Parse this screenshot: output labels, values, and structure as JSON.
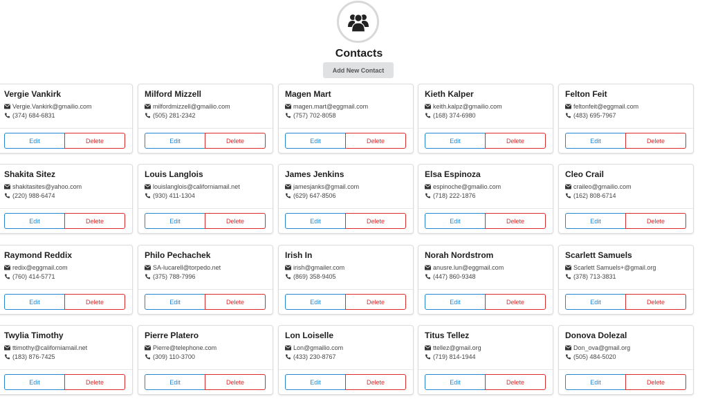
{
  "page": {
    "title": "Contacts",
    "add_button_label": "Add New Contact",
    "logo_icon": "users-icon"
  },
  "colors": {
    "edit": "#2185d0",
    "delete": "#db2828",
    "add_button_bg": "#e0e1e2"
  },
  "labels": {
    "edit": "Edit",
    "delete": "Delete"
  },
  "contacts": [
    {
      "name": "Vergie Vankirk",
      "email": "Vergie.Vankirk@gmailio.com",
      "phone": "(374) 684-6831"
    },
    {
      "name": "Milford Mizzell",
      "email": "milfordmizzell@gmailio.com",
      "phone": "(505) 281-2342"
    },
    {
      "name": "Magen Mart",
      "email": "magen.mart@eggmail.com",
      "phone": "(757) 702-8058"
    },
    {
      "name": "Kieth Kalper",
      "email": "keith.kalpz@gmailio.com",
      "phone": "(168) 374-6980"
    },
    {
      "name": "Felton Feit",
      "email": "feltonfeit@eggmail.com",
      "phone": "(483) 695-7967"
    },
    {
      "name": "Shakita Sitez",
      "email": "shakitasites@yahoo.com",
      "phone": "(220) 988-6474"
    },
    {
      "name": "Louis Langlois",
      "email": "louislanglois@californiamail.net",
      "phone": "(930) 411-1304"
    },
    {
      "name": "James Jenkins",
      "email": "jamesjanks@gmail.com",
      "phone": "(629) 647-8506"
    },
    {
      "name": "Elsa Espinoza",
      "email": "espinoche@gmailio.com",
      "phone": "(718) 222-1876"
    },
    {
      "name": "Cleo Crail",
      "email": "craileo@gmailio.com",
      "phone": "(162) 808-6714"
    },
    {
      "name": "Raymond Reddix",
      "email": "redix@eggmail.com",
      "phone": "(760) 414-5771"
    },
    {
      "name": "Philo Pechachek",
      "email": "SA-lucarell@torpedo.net",
      "phone": "(375) 788-7996"
    },
    {
      "name": "Irish In",
      "email": "irish@gmailer.com",
      "phone": "(869) 358-9405"
    },
    {
      "name": "Norah Nordstrom",
      "email": "anusre.lun@eggmail.com",
      "phone": "(447) 860-9348"
    },
    {
      "name": "Scarlett Samuels",
      "email": "Scarlett Samuels+@gmail.org",
      "phone": "(378) 713-3831"
    },
    {
      "name": "Twylia Timothy",
      "email": "ttimothy@californiamail.net",
      "phone": "(183) 876-7425"
    },
    {
      "name": "Pierre Platero",
      "email": "Pierre@telephone.com",
      "phone": "(309) 110-3700"
    },
    {
      "name": "Lon Loiselle",
      "email": "Lon@gmailio.com",
      "phone": "(433) 230-8767"
    },
    {
      "name": "Titus Tellez",
      "email": "ttellez@gmail.org",
      "phone": "(719) 814-1944"
    },
    {
      "name": "Donova Dolezal",
      "email": "Don_ova@gmail.org",
      "phone": "(505) 484-5020"
    }
  ]
}
